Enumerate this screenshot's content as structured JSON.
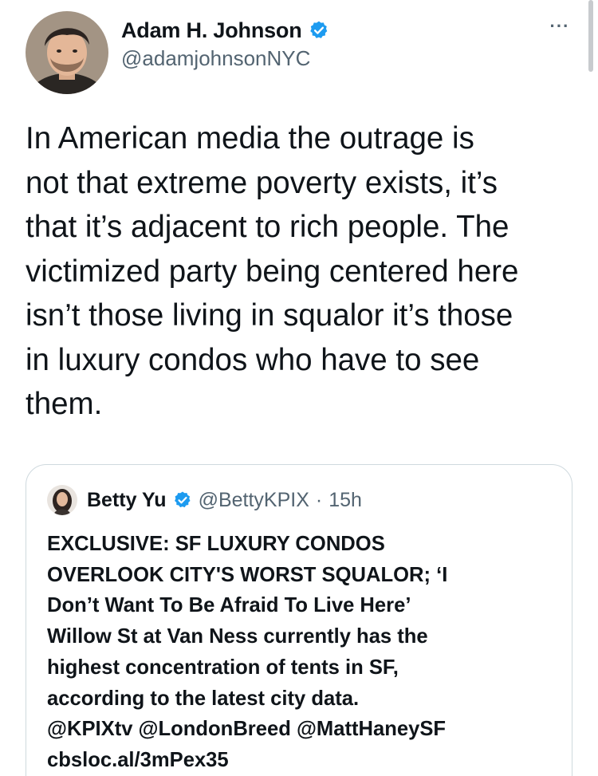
{
  "author": {
    "display_name": "Adam H. Johnson",
    "handle": "@adamjohnsonNYC",
    "verified_icon": "verified-badge-icon"
  },
  "menu": {
    "more_label": "···"
  },
  "tweet": {
    "text": "In American media the outrage is\nnot that extreme poverty exists, it’s\nthat it’s adjacent to rich people. The\nvictimized party being centered here\nisn’t those living in squalor it’s those\nin luxury condos who have to see\nthem."
  },
  "quoted_tweet": {
    "display_name": "Betty Yu",
    "handle": "@BettyKPIX",
    "separator": "·",
    "time": "15h",
    "text": "EXCLUSIVE: SF LUXURY CONDOS\nOVERLOOK CITY'S WORST SQUALOR; ‘I\nDon’t Want To Be Afraid To Live Here’\nWillow St at Van Ness currently has the\nhighest concentration of tents in SF,\naccording to the latest city data.\n@KPIXtv @LondonBreed @MattHaneySF\ncbsloc.al/3mPex35"
  },
  "colors": {
    "text_primary": "#0f1419",
    "text_secondary": "#536471",
    "verified_blue": "#1d9bf0",
    "border": "#cfd9de"
  }
}
